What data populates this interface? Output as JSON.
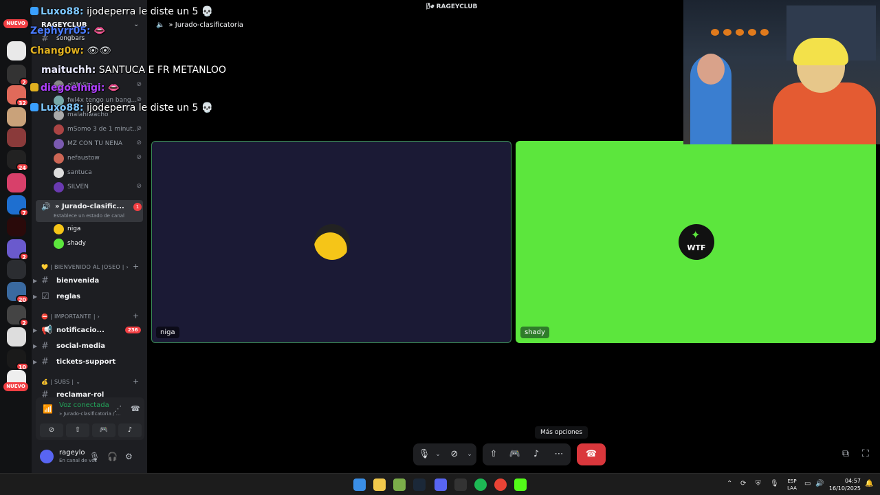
{
  "window": {
    "title": "RAGEYCLUB"
  },
  "rail": {
    "badges": [
      "2",
      "32",
      "24",
      "7",
      "2",
      "20",
      "2",
      "10"
    ],
    "new_label": "NUEVO"
  },
  "sidebar": {
    "server_name": "RAGEYCLUB",
    "partial_channel": "songbars",
    "members_top": [
      "elMASte...",
      "fwl4x tengo un bang...",
      "malahiwacho",
      "mSomo 3 de 1 minut...",
      "MZ CON TU NENA",
      "nefaustow",
      "santuca",
      "SILVEN"
    ],
    "active_voice": {
      "name": "» Jurado-clasific...",
      "status": "Establece un estado de canal",
      "badge": "1"
    },
    "voice_members": [
      "niga",
      "shady"
    ],
    "categories": [
      {
        "label": "| BIENVENIDO AL JOSEO |",
        "channels": [
          "bienvenida",
          "reglas"
        ]
      },
      {
        "label": "| IMPORTANTE |",
        "channels": [
          "notificacio...",
          "social-media",
          "tickets-support"
        ]
      },
      {
        "label": "| SUBS |",
        "channels": [
          "reclamar-rol"
        ]
      }
    ],
    "notif_count": "236",
    "nuevo_badge": "NUEVO"
  },
  "voice_panel": {
    "title": "Voz conectada",
    "subtitle": "» Jurado-clasificatoria / ..."
  },
  "user_panel": {
    "name": "rageylo",
    "status": "En canal de voz"
  },
  "main": {
    "channel_title": "» Jurado-clasificatoria",
    "tiles": [
      {
        "name": "niga",
        "bg": "#1b1a35"
      },
      {
        "name": "shady",
        "bg": "#5ce63d",
        "avatar_text": "WTF"
      }
    ],
    "tooltip": "Más opciones"
  },
  "chat": [
    {
      "user": "Luxo88:",
      "color": "#7ec8ff",
      "msg": "ijodeperra le diste un 5"
    },
    {
      "user": "Zephyrr05:",
      "color": "#4a7bff",
      "msg": ""
    },
    {
      "user": "Chang0w:",
      "color": "#e0b020",
      "msg": ""
    },
    {
      "user": "maituchh:",
      "color": "#e8e8ff",
      "msg": "SANTUCA E FR METANLOO"
    },
    {
      "user": "diegoelnigi:",
      "color": "#b040ff",
      "msg": ""
    },
    {
      "user": "Luxo88:",
      "color": "#7ec8ff",
      "msg": "ijodeperra le diste un 5"
    }
  ],
  "taskbar": {
    "lang1": "ESP",
    "lang2": "LAA",
    "time": "04:57",
    "date": "16/10/2025"
  },
  "colors": {
    "accent_green": "#23a55a",
    "danger": "#da373c",
    "tile_green": "#5ce63d"
  }
}
